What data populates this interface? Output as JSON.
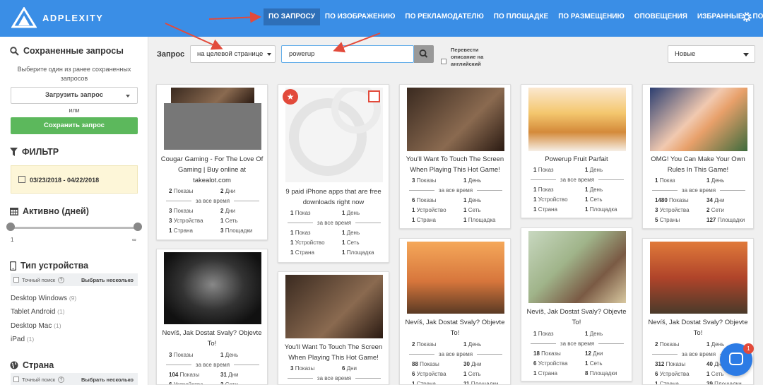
{
  "app": {
    "name": "ADPLEXITY"
  },
  "nav": {
    "items": [
      "ПО ЗАПРОСУ",
      "ПО ИЗОБРАЖЕНИЮ",
      "ПО РЕКЛАМОДАТЕЛЮ",
      "ПО ПЛОЩАДКЕ",
      "ПО РАЗМЕЩЕНИЮ",
      "ОПОВЕЩЕНИЯ",
      "ИЗБРАННЫЕ",
      "ПОМОЩЬ"
    ],
    "active_index": 0,
    "settings_icon": "gear-icon"
  },
  "sidebar": {
    "saved_title": "Сохраненные запросы",
    "saved_hint": "Выберите один из ранее сохраненных запросов",
    "load_button": "Загрузить запрос",
    "or": "или",
    "save_button": "Сохранить запрос",
    "filter_title": "ФИЛЬТР",
    "date_range": "03/23/2018 - 04/22/2018",
    "active_title": "Активно (дней)",
    "slider_min": "1",
    "slider_max": "∞",
    "device_title": "Тип устройства",
    "exact_search": "Точный поиск",
    "choose_multiple": "Выбрать несколько",
    "devices": [
      {
        "name": "Desktop Windows",
        "count": "(9)"
      },
      {
        "name": "Tablet Android",
        "count": "(1)"
      },
      {
        "name": "Desktop Mac",
        "count": "(1)"
      },
      {
        "name": "iPad",
        "count": "(1)"
      }
    ],
    "country_title": "Страна"
  },
  "query": {
    "label": "Запрос",
    "scope": "на целевой странице",
    "value": "powerup",
    "translate_label": "Перевести описание на английский",
    "sort": "Новые"
  },
  "stats_label": "за все время",
  "cards": [
    {
      "title": "Cougar Gaming - For The Love Of Gaming | Buy online at takealot.com",
      "top": [
        [
          "2",
          "Показы"
        ],
        [
          "2",
          "Дни"
        ]
      ],
      "rows": [
        [
          [
            "3",
            "Показы"
          ],
          [
            "2",
            "Дни"
          ]
        ],
        [
          [
            "3",
            "Устройства"
          ],
          [
            "1",
            "Сеть"
          ]
        ],
        [
          [
            "1",
            "Страна"
          ],
          [
            "3",
            "Площадки"
          ]
        ]
      ]
    },
    {
      "title": "9 paid iPhone apps that are free downloads right now",
      "top": [
        [
          "1",
          "Показ"
        ],
        [
          "1",
          "День"
        ]
      ],
      "rows": [
        [
          [
            "1",
            "Показ"
          ],
          [
            "1",
            "День"
          ]
        ],
        [
          [
            "1",
            "Устройство"
          ],
          [
            "1",
            "Сеть"
          ]
        ],
        [
          [
            "1",
            "Страна"
          ],
          [
            "1",
            "Площадка"
          ]
        ]
      ]
    },
    {
      "title": "You'll Want To Touch The Screen When Playing This Hot Game!",
      "top": [
        [
          "3",
          "Показы"
        ],
        [
          "1",
          "День"
        ]
      ],
      "rows": [
        [
          [
            "6",
            "Показы"
          ],
          [
            "1",
            "День"
          ]
        ],
        [
          [
            "1",
            "Устройство"
          ],
          [
            "1",
            "Сеть"
          ]
        ],
        [
          [
            "1",
            "Страна"
          ],
          [
            "1",
            "Площадка"
          ]
        ]
      ]
    },
    {
      "title": "Powerup Fruit Parfait",
      "top": [
        [
          "1",
          "Показ"
        ],
        [
          "1",
          "День"
        ]
      ],
      "rows": [
        [
          [
            "1",
            "Показ"
          ],
          [
            "1",
            "День"
          ]
        ],
        [
          [
            "1",
            "Устройство"
          ],
          [
            "1",
            "Сеть"
          ]
        ],
        [
          [
            "1",
            "Страна"
          ],
          [
            "1",
            "Площадка"
          ]
        ]
      ]
    },
    {
      "title": "OMG! You Can Make Your Own Rules In This Game!",
      "top": [
        [
          "1",
          "Показ"
        ],
        [
          "1",
          "День"
        ]
      ],
      "rows": [
        [
          [
            "1480",
            "Показы"
          ],
          [
            "34",
            "Дни"
          ]
        ],
        [
          [
            "3",
            "Устройства"
          ],
          [
            "2",
            "Сети"
          ]
        ],
        [
          [
            "5",
            "Страны"
          ],
          [
            "127",
            "Площадки"
          ]
        ]
      ]
    },
    {
      "title": "Nevíš, Jak Dostat Svaly? Objevte To!",
      "top": [
        [
          "3",
          "Показы"
        ],
        [
          "1",
          "День"
        ]
      ],
      "rows": [
        [
          [
            "104",
            "Показы"
          ],
          [
            "31",
            "Дни"
          ]
        ],
        [
          [
            "6",
            "Устройства"
          ],
          [
            "3",
            "Сети"
          ]
        ]
      ]
    },
    {
      "title": "You'll Want To Touch The Screen When Playing This Hot Game!",
      "top": [
        [
          "3",
          "Показы"
        ],
        [
          "6",
          "Дни"
        ]
      ],
      "rows": []
    },
    {
      "title": "Nevíš, Jak Dostat Svaly? Objevte To!",
      "top": [
        [
          "2",
          "Показы"
        ],
        [
          "1",
          "День"
        ]
      ],
      "rows": [
        [
          [
            "88",
            "Показы"
          ],
          [
            "30",
            "Дни"
          ]
        ],
        [
          [
            "6",
            "Устройства"
          ],
          [
            "1",
            "Сеть"
          ]
        ],
        [
          [
            "1",
            "Страна"
          ],
          [
            "11",
            "Площадки"
          ]
        ]
      ]
    },
    {
      "title": "Nevíš, Jak Dostat Svaly? Objevte To!",
      "top": [
        [
          "1",
          "Показ"
        ],
        [
          "1",
          "День"
        ]
      ],
      "rows": [
        [
          [
            "18",
            "Показы"
          ],
          [
            "12",
            "Дни"
          ]
        ],
        [
          [
            "6",
            "Устройства"
          ],
          [
            "1",
            "Сеть"
          ]
        ],
        [
          [
            "1",
            "Страна"
          ],
          [
            "8",
            "Площадки"
          ]
        ]
      ]
    },
    {
      "title": "Nevíš, Jak Dostat Svaly? Objevte To!",
      "top": [
        [
          "2",
          "Показы"
        ],
        [
          "1",
          "День"
        ]
      ],
      "rows": [
        [
          [
            "312",
            "Показы"
          ],
          [
            "40",
            "Дни"
          ]
        ],
        [
          [
            "6",
            "Устройства"
          ],
          [
            "1",
            "Сеть"
          ]
        ],
        [
          [
            "1",
            "Страна"
          ],
          [
            "39",
            "Площадки"
          ]
        ]
      ]
    }
  ],
  "chat": {
    "badge": "1"
  },
  "colors": {
    "header": "#3a8ee6",
    "active_nav": "#2e6fb8",
    "save_button": "#5cb85c",
    "annotation": "#e24a3b"
  }
}
